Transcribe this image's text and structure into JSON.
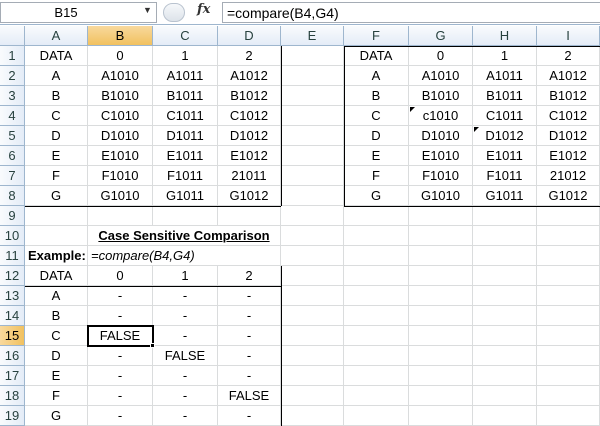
{
  "namebox": {
    "value": "B15",
    "arrow": "▼"
  },
  "fx_label": "fx",
  "formula": "=compare(B4,G4)",
  "columns": [
    "A",
    "B",
    "C",
    "D",
    "E",
    "F",
    "G",
    "H",
    "I"
  ],
  "rows": [
    "1",
    "2",
    "3",
    "4",
    "5",
    "6",
    "7",
    "8",
    "9",
    "10",
    "11",
    "12",
    "13",
    "14",
    "15",
    "16",
    "17",
    "18",
    "19"
  ],
  "left_table": {
    "header": [
      "DATA",
      "0",
      "1",
      "2"
    ],
    "rows": [
      [
        "A",
        "A1010",
        "A1011",
        "A1012"
      ],
      [
        "B",
        "B1010",
        "B1011",
        "B1012"
      ],
      [
        "C",
        "C1010",
        "C1011",
        "C1012"
      ],
      [
        "D",
        "D1010",
        "D1011",
        "D1012"
      ],
      [
        "E",
        "E1010",
        "E1011",
        "E1012"
      ],
      [
        "F",
        "F1010",
        "F1011",
        "21011"
      ],
      [
        "G",
        "G1010",
        "G1011",
        "G1012"
      ]
    ]
  },
  "right_table": {
    "header": [
      "DATA",
      "0",
      "1",
      "2"
    ],
    "rows": [
      [
        "A",
        "A1010",
        "A1011",
        "A1012"
      ],
      [
        "B",
        "B1010",
        "B1011",
        "B1012"
      ],
      [
        "C",
        "c1010",
        "C1011",
        "C1012"
      ],
      [
        "D",
        "D1010",
        "D1012",
        "D1012"
      ],
      [
        "E",
        "E1010",
        "E1011",
        "E1012"
      ],
      [
        "F",
        "F1010",
        "F1011",
        "21012"
      ],
      [
        "G",
        "G1010",
        "G1011",
        "G1012"
      ]
    ]
  },
  "section_title": "Case Sensitive Comparison",
  "example_label": "Example:",
  "example_formula": "=compare(B4,G4)",
  "result_table": {
    "header": [
      "DATA",
      "0",
      "1",
      "2"
    ],
    "rows": [
      [
        "A",
        "-",
        "-",
        "-"
      ],
      [
        "B",
        "-",
        "-",
        "-"
      ],
      [
        "C",
        "FALSE",
        "-",
        "-"
      ],
      [
        "D",
        "-",
        "FALSE",
        "-"
      ],
      [
        "E",
        "-",
        "-",
        "-"
      ],
      [
        "F",
        "-",
        "-",
        "FALSE"
      ],
      [
        "G",
        "-",
        "-",
        "-"
      ]
    ]
  },
  "selected_cell": "B15"
}
